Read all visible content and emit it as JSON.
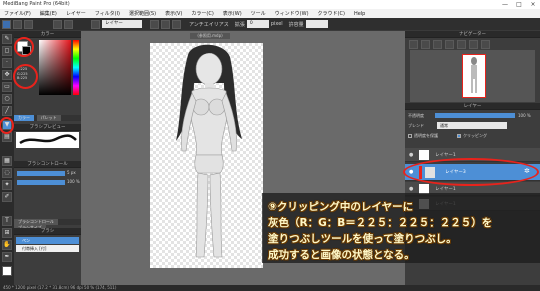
{
  "window": {
    "title": "MediBang Paint Pro (64bit)",
    "controls": [
      "—",
      "□",
      "×"
    ]
  },
  "menu": [
    "ファイル(F)",
    "編集(E)",
    "レイヤー",
    "フィルタ(I)",
    "選択範囲(S)",
    "表示(V)",
    "カラー(C)",
    "表示(W)",
    "ツール",
    "ウィンドウ(W)",
    "クラウド(C)",
    "Help"
  ],
  "toolbar": {
    "target_label": "レイヤー",
    "antialias_label": "アンチエイリアス",
    "expand_label": "拡張",
    "expand_value": "0",
    "unit": "pixel",
    "tolerance_label": "許容量"
  },
  "doc_tab": "(参照用.mdp)",
  "left": {
    "color_header": "カラー",
    "rgb_readout": [
      "R:225",
      "G:225",
      "B:225"
    ],
    "tabs": [
      "カラー",
      "パレット"
    ],
    "brush_preview_header": "ブラシプレビュー",
    "brush_control_header": "ブラシコントロール",
    "brush_size": "5 px",
    "brush_opacity": "100 %",
    "brush_tabs": [
      "ブラシコントロール",
      "ブラシサイズ"
    ],
    "brush_list_header": "ブラシ",
    "brush_items": [
      "ペン",
      "付帯挿入 [付]"
    ]
  },
  "right": {
    "navigator_header": "ナビゲーター",
    "layer_header": "レイヤー",
    "opacity_label": "不透明度",
    "opacity_value": "100 %",
    "blend_label": "ブレンド",
    "blend_value": "通常",
    "protect_label": "透明度を保護",
    "clipping_label": "クリッピング",
    "layers": [
      {
        "name": "レイヤー1"
      },
      {
        "name": "レイヤー3"
      },
      {
        "name": "レイヤー1"
      },
      {
        "name": "レイヤー1"
      }
    ]
  },
  "status": "450 * 1200 pixel (17.2 * 31.8cm) 96 dpi 50 % (174, 511)",
  "caption": [
    "⑨クリッピング中のレイヤーに",
    "灰色（R：G：B＝２２５：２２５：２２５）を",
    "塗りつぶしツールを使って塗りつぶし。",
    "成功すると画像の状態となる。"
  ],
  "colors": {
    "accent": "#4d8fd6",
    "annotation": "#e8231c",
    "caption_text": "#fff8c8"
  }
}
